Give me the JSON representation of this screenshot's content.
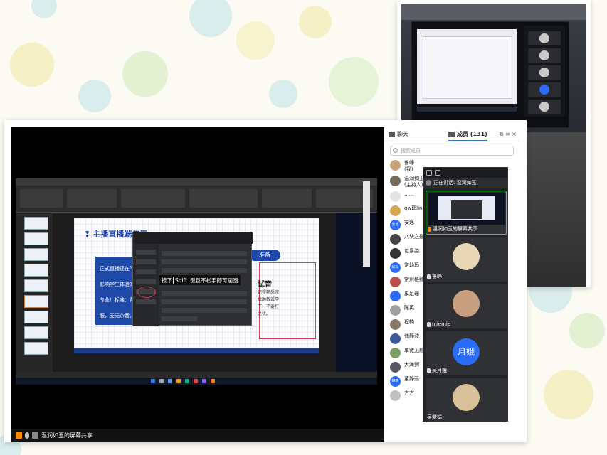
{
  "colors": {
    "accent_blue": "#2b6cf6",
    "slide_blue": "#1f49a8",
    "active_green": "#39d353",
    "highlight_red": "#d83a4a",
    "share_orange": "#ff8a00"
  },
  "slide": {
    "title": "主播直播端使用",
    "bluebox_lines": [
      "正式直播还在不仅",
      "影响学生体验的",
      "专业！标准：背",
      "服，麦无杂音，"
    ],
    "pill": "准备",
    "subheading": "试音",
    "right_lines": [
      "记得熟悉完",
      "找助教或学",
      "下，不要打",
      "之优。"
    ]
  },
  "obs_hint": {
    "before": "按下",
    "key": "Shift",
    "after": "键且不松手即可画圆"
  },
  "share_bar": {
    "text": "温润如玉的屏幕共享"
  },
  "members_panel": {
    "tab_chat": "聊天",
    "tab_members": "成员 (131)",
    "search_placeholder": "搜索成员",
    "members": [
      {
        "name": "鲁峥",
        "sub": "(我)"
      },
      {
        "name": "温润如玉",
        "sub": "(主持人)"
      },
      {
        "name": "......",
        "sub": ""
      },
      {
        "name": "qw耶lin朵",
        "sub": ""
      },
      {
        "name": "安逸",
        "sub": ""
      },
      {
        "name": "八块之最",
        "sub": ""
      },
      {
        "name": "包易姿",
        "sub": ""
      },
      {
        "name": "常幼玛",
        "sub": ""
      },
      {
        "name": "常州格致",
        "sub": ""
      },
      {
        "name": "巢足珊",
        "sub": ""
      },
      {
        "name": "陈英",
        "sub": ""
      },
      {
        "name": "程楠",
        "sub": ""
      },
      {
        "name": "储静波",
        "sub": ""
      },
      {
        "name": "单微无痕",
        "sub": ""
      },
      {
        "name": "大海狮",
        "sub": ""
      },
      {
        "name": "董静丽",
        "sub": ""
      },
      {
        "name": "方方",
        "sub": ""
      }
    ],
    "member_avatar_texts": [
      "安逸",
      "幼冯",
      "无瑕",
      "静丽"
    ]
  },
  "video_tiles": {
    "speaking_label": "正在讲话: 温润如玉,",
    "tiles": [
      {
        "label": "温润如玉的屏幕共享"
      },
      {
        "label": "鲁峥"
      },
      {
        "label": "miemie"
      },
      {
        "label": "吴月娥",
        "avatar_text": "月娥"
      },
      {
        "label": "吴紫娟"
      }
    ]
  }
}
